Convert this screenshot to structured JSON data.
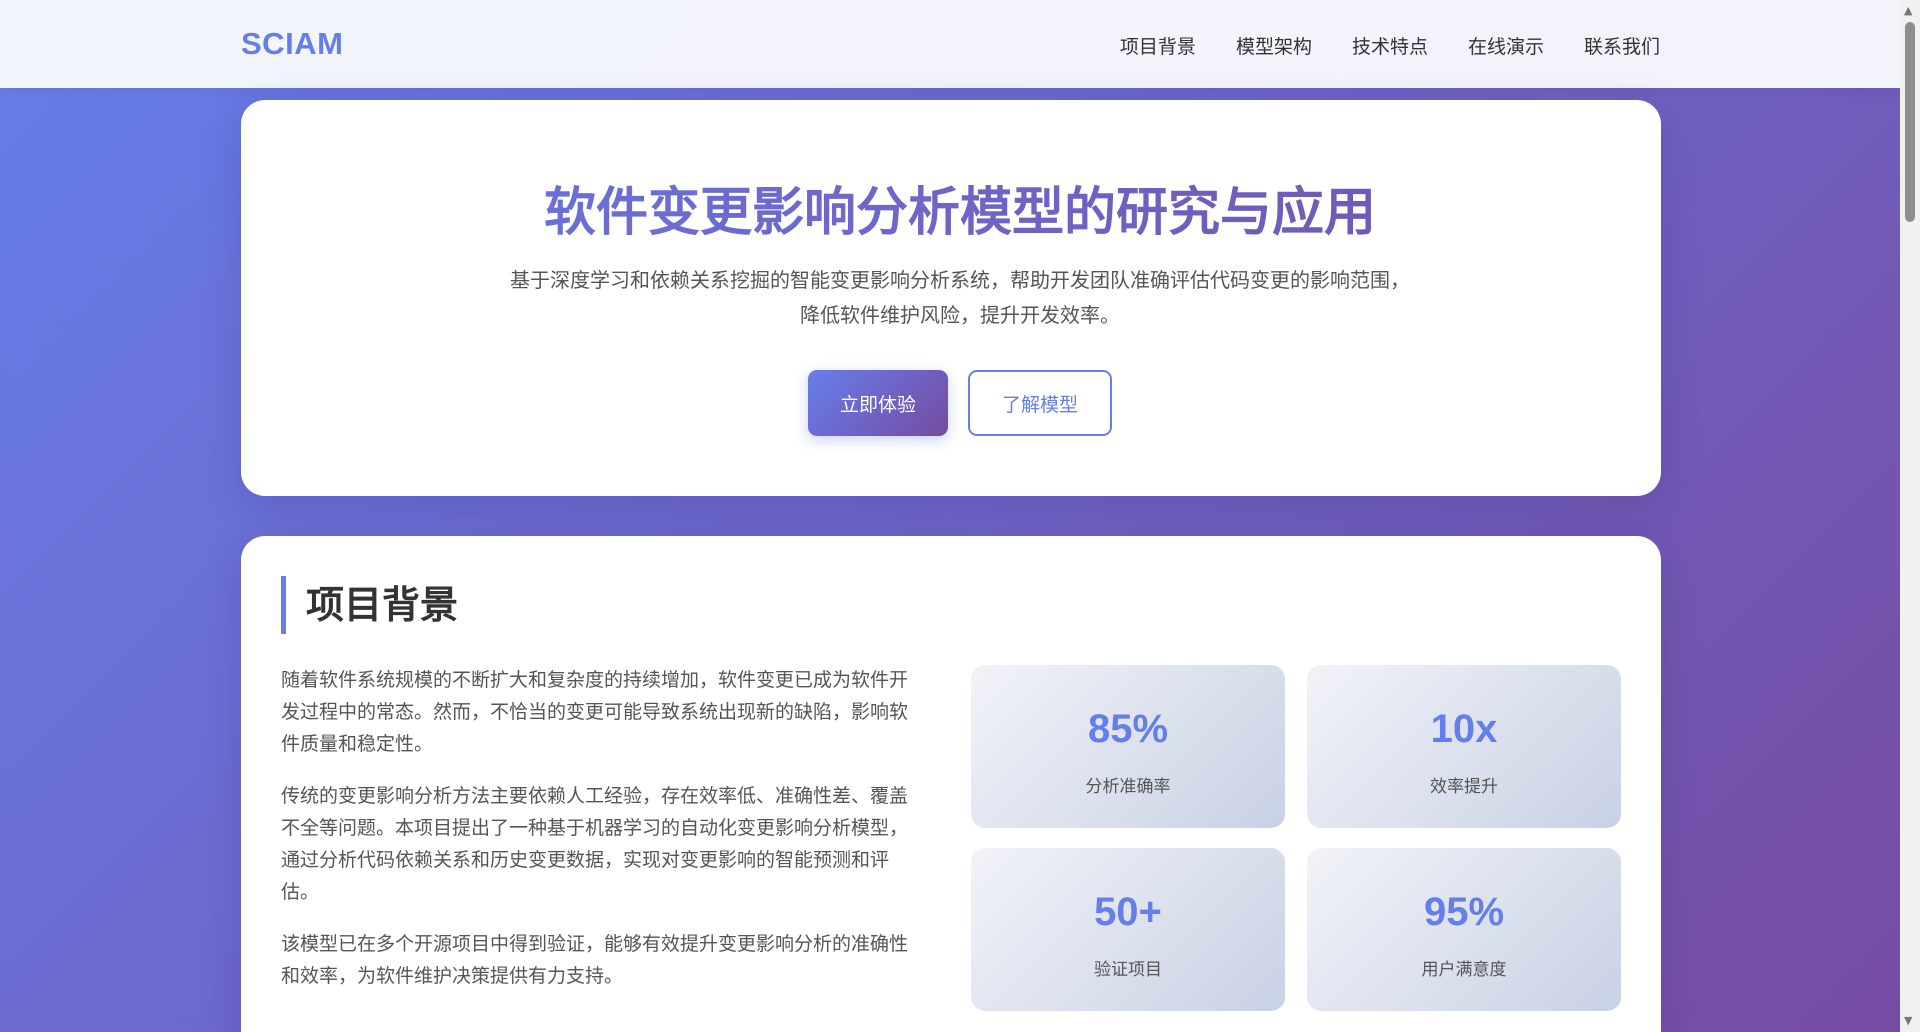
{
  "nav": {
    "brand": "SCIAM",
    "links": [
      "项目背景",
      "模型架构",
      "技术特点",
      "在线演示",
      "联系我们"
    ]
  },
  "hero": {
    "title": "软件变更影响分析模型的研究与应用",
    "subtitle_line1": "基于深度学习和依赖关系挖掘的智能变更影响分析系统，帮助开发团队准确评估代码变更的影响范围，",
    "subtitle_line2": "降低软件维护风险，提升开发效率。",
    "primary_button": "立即体验",
    "secondary_button": "了解模型"
  },
  "background": {
    "title": "项目背景",
    "paragraphs": [
      "随着软件系统规模的不断扩大和复杂度的持续增加，软件变更已成为软件开发过程中的常态。然而，不恰当的变更可能导致系统出现新的缺陷，影响软件质量和稳定性。",
      "传统的变更影响分析方法主要依赖人工经验，存在效率低、准确性差、覆盖不全等问题。本项目提出了一种基于机器学习的自动化变更影响分析模型，通过分析代码依赖关系和历史变更数据，实现对变更影响的智能预测和评估。",
      "该模型已在多个开源项目中得到验证，能够有效提升变更影响分析的准确性和效率，为软件维护决策提供有力支持。"
    ],
    "stats": [
      {
        "value": "85%",
        "label": "分析准确率"
      },
      {
        "value": "10x",
        "label": "效率提升"
      },
      {
        "value": "50+",
        "label": "验证项目"
      },
      {
        "value": "95%",
        "label": "用户满意度"
      }
    ]
  },
  "colors": {
    "accent": "#667eea",
    "accent_end": "#764ba2"
  }
}
